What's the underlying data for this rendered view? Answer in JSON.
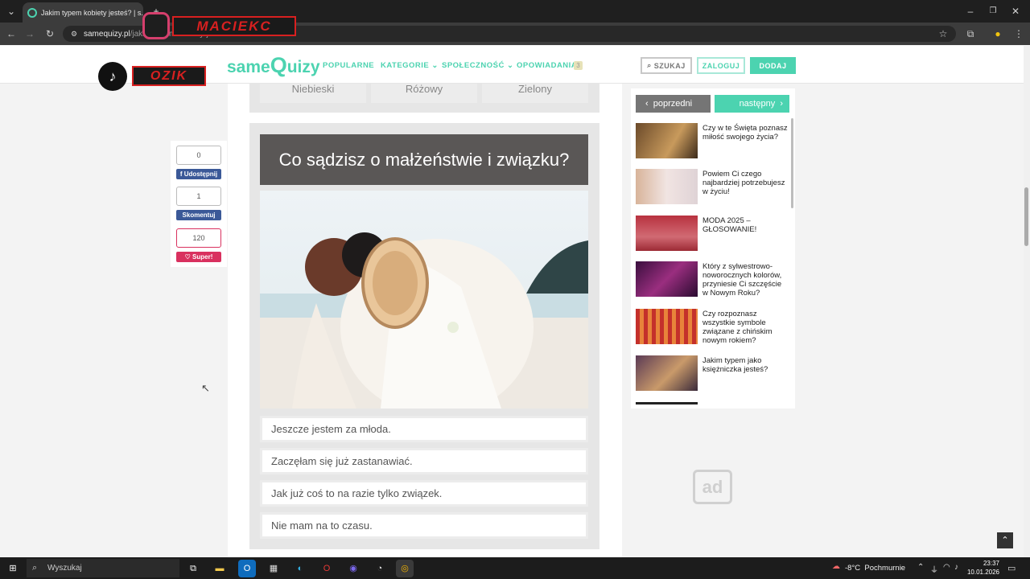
{
  "browser": {
    "tab_title": "Jakim typem kobiety jesteś? | s...",
    "url_domain": "samequizy.pl",
    "url_path": "/jakim-typem-kobiety-jestes-12"
  },
  "overlays": {
    "maciek": "MACIEKC",
    "ozik": "OZIK"
  },
  "site": {
    "logo_prefix": "same",
    "logo_q": "Q",
    "logo_suffix": "uizy",
    "nav": [
      "POPULARNE",
      "KATEGORIE ⌄",
      "SPOŁECZNOŚĆ ⌄",
      "OPOWIADANIA"
    ],
    "nav_badge": "3",
    "search_label": "SZUKAJ",
    "login_label": "ZALOGUJ",
    "add_label": "DODAJ",
    "accent": "#4cd3b0"
  },
  "prev_options": [
    "Niebieski",
    "Różowy",
    "Zielony"
  ],
  "question": {
    "title": "Co sądzisz o małżeństwie i związku?",
    "answers": [
      "Jeszcze jestem za młoda.",
      "Zaczęłam się już zastanawiać.",
      "Jak już coś to na razie tylko związek.",
      "Nie mam na to czasu."
    ]
  },
  "share": {
    "share_count": "0",
    "share_label": "Udostępnij",
    "comment_count": "1",
    "comment_label": "Skomentuj",
    "super_count": "120",
    "super_label": "Super!"
  },
  "sidebar": {
    "prev_label": "poprzedni",
    "next_label": "następny",
    "items": [
      {
        "text": "Czy w te Święta poznasz miłość swojego życia?"
      },
      {
        "text": "Powiem Ci czego najbardziej potrzebujesz w życiu!"
      },
      {
        "text": "MODA 2025 – GŁOSOWANIE!"
      },
      {
        "text": "Który z sylwestrowo-noworocznych kolorów, przyniesie Ci szczęście w Nowym Roku?"
      },
      {
        "text": "Czy rozpoznasz wszystkie symbole związane z chińskim nowym rokiem?"
      },
      {
        "text": "Jakim typem jako księżniczka jesteś?"
      }
    ],
    "ad_label": "ad"
  },
  "taskbar": {
    "search_placeholder": "Wyszukaj",
    "temperature": "-8°C",
    "weather": "Pochmurnie",
    "time": "23:37",
    "date": "10.01.2026"
  }
}
